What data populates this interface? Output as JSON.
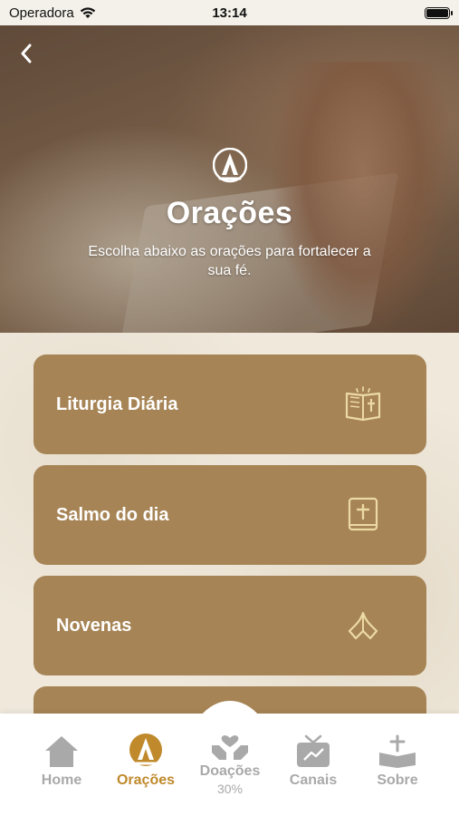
{
  "status_bar": {
    "carrier": "Operadora",
    "time": "13:14"
  },
  "header": {
    "title": "Orações",
    "subtitle": "Escolha abaixo as orações para fortalecer a sua fé."
  },
  "menu": [
    {
      "label": "Liturgia Diária",
      "icon": "open-bible-icon"
    },
    {
      "label": "Salmo do dia",
      "icon": "bible-cross-icon"
    },
    {
      "label": "Novenas",
      "icon": "praying-hands-icon"
    }
  ],
  "tabs": [
    {
      "label": "Home",
      "icon": "home-icon",
      "active": false
    },
    {
      "label": "Orações",
      "icon": "praying-hands-icon",
      "active": true
    },
    {
      "label": "Doações",
      "icon": "donation-hands-icon",
      "active": false,
      "badge": "30%"
    },
    {
      "label": "Canais",
      "icon": "tv-icon",
      "active": false
    },
    {
      "label": "Sobre",
      "icon": "book-cross-icon",
      "active": false
    }
  ],
  "colors": {
    "card": "#a68455",
    "accent": "#c08a2c",
    "tab_inactive": "#a9a9a9",
    "icon_gold": "#ecd9a3"
  }
}
